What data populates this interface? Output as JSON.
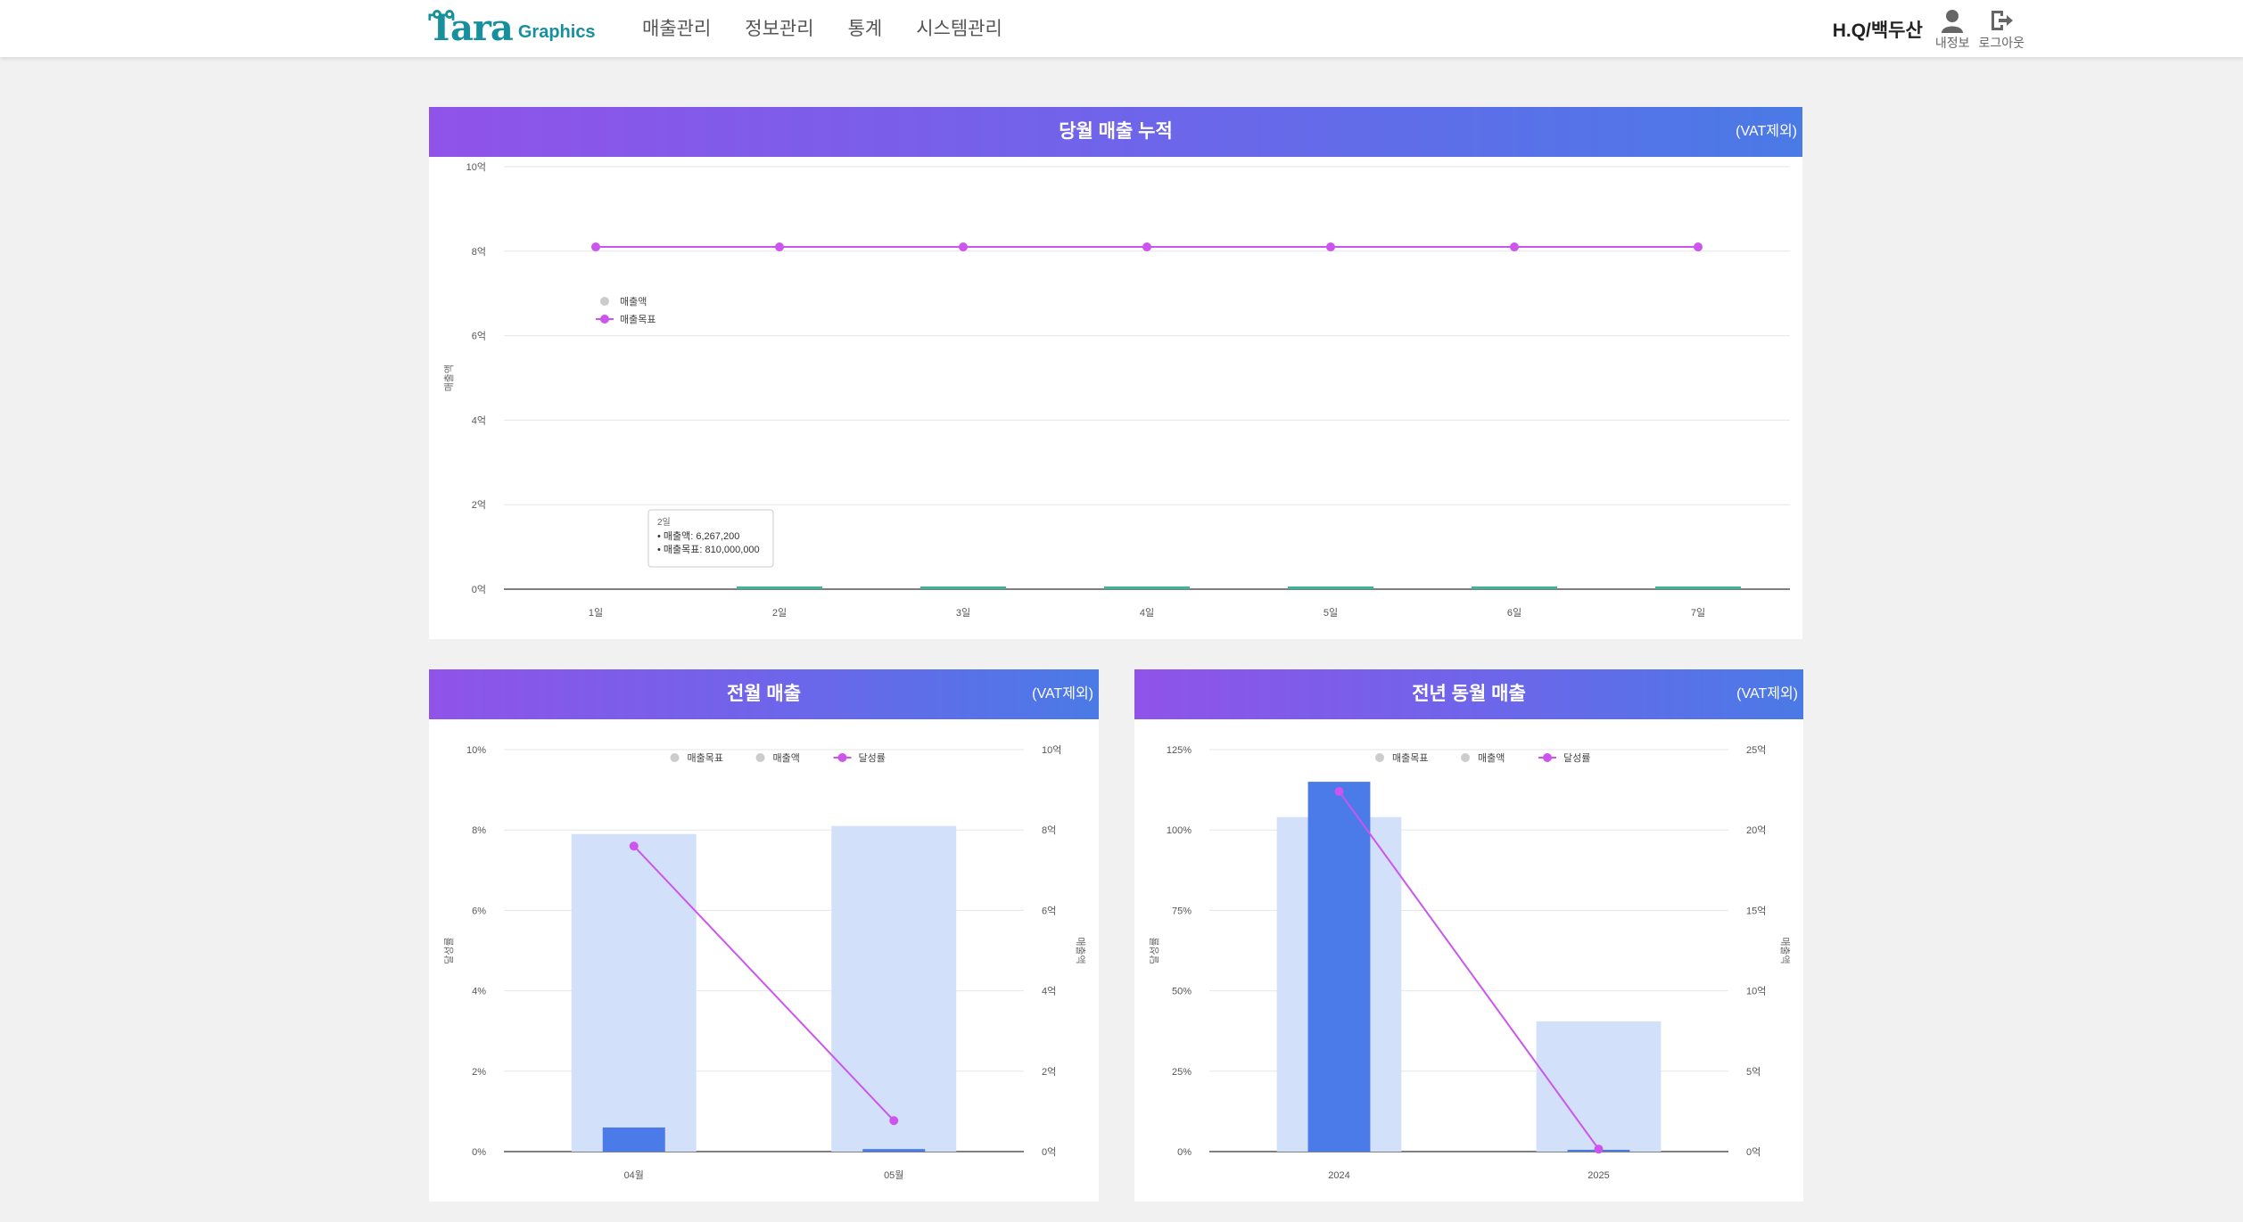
{
  "header": {
    "logo_text": "Tara",
    "logo_sub": "Graphics",
    "nav": [
      {
        "label": "매출관리"
      },
      {
        "label": "정보관리"
      },
      {
        "label": "통계"
      },
      {
        "label": "시스템관리"
      }
    ],
    "user_name": "H.Q/백두산",
    "my_info_label": "내정보",
    "logout_label": "로그아웃",
    "icons": [
      "user-icon",
      "logout-icon"
    ]
  },
  "colors": {
    "header_gradient_start": "#9053ea",
    "header_gradient_end": "#4a7ae6",
    "target_line": "#cc55ee",
    "sales_bar_dark": "#4b7be8",
    "sales_bar_light": "#d3e0fa",
    "daily_bar": "#3cb39a"
  },
  "panels": {
    "monthly_cumulative": {
      "title": "당월 매출 누적",
      "vat_note": "(VAT제외)"
    },
    "prev_month": {
      "title": "전월 매출",
      "vat_note": "(VAT제외)"
    },
    "prev_year": {
      "title": "전년 동월 매출",
      "vat_note": "(VAT제외)"
    }
  },
  "chart_data": [
    {
      "type": "line",
      "x": [
        "1일",
        "2일",
        "3일",
        "4일",
        "5일",
        "6일",
        "7일"
      ],
      "y_ticks": [
        "0억",
        "2억",
        "4억",
        "6억",
        "8억",
        "10억"
      ],
      "ylim": [
        0,
        1000000000
      ],
      "ylabel": "매출액",
      "legend": [
        "매출액",
        "매출목표"
      ],
      "legend_position": "top-left",
      "series": [
        {
          "name": "매출액",
          "type": "bar",
          "values": [
            0,
            6267200,
            6267200,
            6267200,
            6267200,
            6267200,
            6267200
          ]
        },
        {
          "name": "매출목표",
          "type": "line",
          "values": [
            810000000,
            810000000,
            810000000,
            810000000,
            810000000,
            810000000,
            810000000
          ]
        }
      ],
      "tooltip": {
        "title": "2일",
        "line1": "매출액: 6,267,200",
        "line2": "매출목표: 810,000,000"
      }
    },
    {
      "type": "bar",
      "categories": [
        "04월",
        "05월"
      ],
      "y_left_ticks": [
        "0%",
        "2%",
        "4%",
        "6%",
        "8%",
        "10%"
      ],
      "y_right_ticks": [
        "0억",
        "2억",
        "4억",
        "6억",
        "8억",
        "10억"
      ],
      "ylim_left": [
        0,
        10
      ],
      "ylim_right": [
        0,
        1000000000
      ],
      "ylabel_left": "달성률",
      "ylabel_right": "매출액",
      "legend": [
        "매출목표",
        "매출액",
        "달성률"
      ],
      "legend_position": "top-center",
      "series": [
        {
          "name": "매출목표",
          "values": [
            790000000,
            810000000
          ]
        },
        {
          "name": "매출액",
          "values": [
            60000000,
            6267200
          ]
        },
        {
          "name": "달성률",
          "values": [
            7.6,
            0.77
          ]
        }
      ]
    },
    {
      "type": "bar",
      "categories": [
        "2024",
        "2025"
      ],
      "y_left_ticks": [
        "0%",
        "25%",
        "50%",
        "75%",
        "100%",
        "125%"
      ],
      "y_right_ticks": [
        "0억",
        "5억",
        "10억",
        "15억",
        "20억",
        "25억"
      ],
      "ylim_left": [
        0,
        125
      ],
      "ylim_right": [
        0,
        2500000000
      ],
      "ylabel_left": "달성률",
      "ylabel_right": "매출액",
      "legend": [
        "매출목표",
        "매출액",
        "달성률"
      ],
      "legend_position": "top-center",
      "series": [
        {
          "name": "매출목표",
          "values": [
            2080000000,
            810000000
          ]
        },
        {
          "name": "매출액",
          "values": [
            2300000000,
            6267200
          ]
        },
        {
          "name": "달성률",
          "values": [
            112,
            0.77
          ]
        }
      ]
    }
  ]
}
